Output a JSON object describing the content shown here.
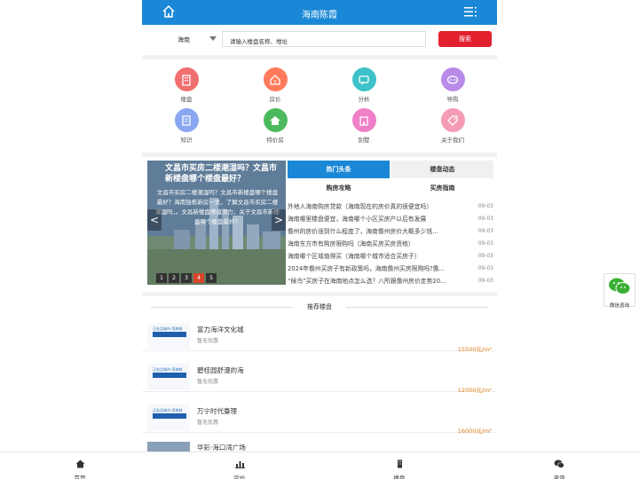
{
  "header": {
    "title": "海南陈霞"
  },
  "search": {
    "region": "海南",
    "placeholder": "请输入楼盘名称、地址",
    "button": "搜索"
  },
  "nav": [
    {
      "label": "楼盘",
      "icon": "building-icon",
      "color": "#f06f6f"
    },
    {
      "label": "房价",
      "icon": "house-price-icon",
      "color": "#ff7b5c"
    },
    {
      "label": "分析",
      "icon": "chat-analysis-icon",
      "color": "#3cc2c8"
    },
    {
      "label": "导购",
      "icon": "guide-icon",
      "color": "#b98be8"
    },
    {
      "label": "知识",
      "icon": "book-icon",
      "color": "#8aa6f0"
    },
    {
      "label": "特价房",
      "icon": "home-icon",
      "color": "#4cba5c"
    },
    {
      "label": "别墅",
      "icon": "villa-icon",
      "color": "#ef7fc6"
    },
    {
      "label": "关于我们",
      "icon": "tag-icon",
      "color": "#f59bb6"
    }
  ],
  "slider": {
    "title": "文昌市买房二楼潮湿吗？文昌市新楼盘哪个楼盘最好？",
    "desc": "文昌市买房二楼潮湿吗？文昌市新楼盘哪个楼盘最好？海南独栋新房一览，了解文昌市买房二楼潮湿吗，。文昌新楼盘增值潜力，关于文昌市新楼盘哪个楼盘最好？",
    "prev": "<",
    "next": ">",
    "pages": [
      "1",
      "2",
      "3",
      "4",
      "5"
    ],
    "active_page": 4
  },
  "tabs": [
    "热门头条",
    "楼盘动态",
    "购房攻略",
    "买房指南"
  ],
  "news": [
    {
      "title": "外地人海南购房贷款（海南现在的房价真的很便宜吗）",
      "date": "09-03"
    },
    {
      "title": "海南哪里楼盘便宜，海南哪个小区买房产以后有发展",
      "date": "09-03"
    },
    {
      "title": "儋州的房价涨到什么程度了，海南儋州房价大概多少钱...",
      "date": "09-03"
    },
    {
      "title": "海南东方市有购房限购吗（海南买房买房资格）",
      "date": "09-03"
    },
    {
      "title": "海南哪个区域值得买（海南哪个城市适合买房子）",
      "date": "09-03"
    },
    {
      "title": "2024年儋州买房子有新政策吗，海南儋州买房限购吗?儋...",
      "date": "09-03"
    },
    {
      "title": "“候鸟”买房子在海南地点怎么选？八所跟儋州房价走势20...",
      "date": "09-03"
    }
  ],
  "recommend": {
    "title": "推荐楼盘",
    "items": [
      {
        "name": "富力海洋文化城",
        "discount": "暂无优惠",
        "price": "15500元/m²",
        "thumb": "正宏品城市·滨海城"
      },
      {
        "name": "碧桂园舒漫的海",
        "discount": "暂无优惠",
        "price": "12000元/m²",
        "thumb": "正宏品城市·滨海城"
      },
      {
        "name": "万宁时代臺理",
        "discount": "暂无优惠",
        "price": "16000元/m²",
        "thumb": "正宏品城市·滨海城"
      },
      {
        "name": "华彩·海口湾广场",
        "discount": "",
        "price": "",
        "thumb": ""
      }
    ]
  },
  "tabbar": [
    {
      "label": "首页",
      "icon": "home-icon"
    },
    {
      "label": "房价",
      "icon": "bar-chart-icon"
    },
    {
      "label": "楼盘",
      "icon": "building-icon"
    },
    {
      "label": "咨询",
      "icon": "wechat-icon"
    }
  ],
  "wechat": {
    "label": "微信咨询"
  },
  "colors": {
    "primary": "#1a88d6",
    "search_button": "#e3202e",
    "price": "#e07b1a"
  }
}
